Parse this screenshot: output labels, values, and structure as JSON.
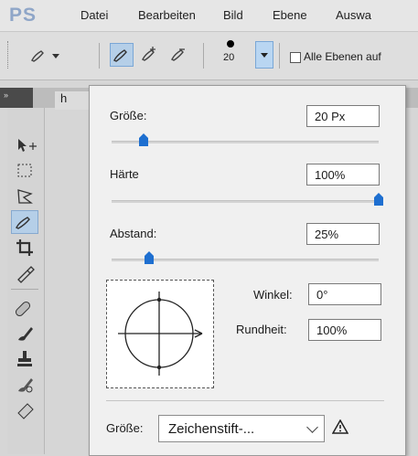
{
  "app": {
    "logo": "PS"
  },
  "menu": {
    "items": [
      "Datei",
      "Bearbeiten",
      "Bild",
      "Ebene",
      "Auswa"
    ]
  },
  "options_bar": {
    "brush_size": "20",
    "sample_all_layers_label": "Alle Ebenen auf",
    "sample_all_layers_checked": false
  },
  "document": {
    "tab_label": "h"
  },
  "brush_panel": {
    "size_label": "Größe:",
    "size_value": "20 Px",
    "hardness_label": "Härte",
    "hardness_value": "100%",
    "spacing_label": "Abstand:",
    "spacing_value": "25%",
    "angle_label": "Winkel:",
    "angle_value": "0°",
    "roundness_label": "Rundheit:",
    "roundness_value": "100%",
    "size_control_label": "Größe:",
    "size_control_value": "Zeichenstift-...",
    "size_pct": 0.12,
    "hardness_pct": 1.0,
    "spacing_pct": 0.14
  },
  "colors": {
    "accent": "#1e6fd0",
    "active_tool_bg": "#b5cfe8"
  }
}
